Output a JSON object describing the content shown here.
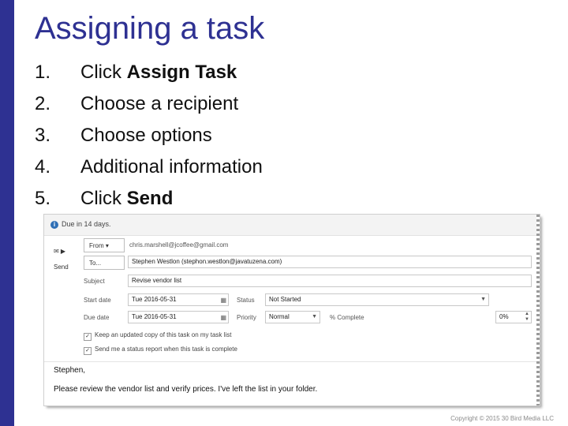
{
  "slide": {
    "title": "Assigning a task",
    "steps": [
      {
        "num": "1.",
        "pre": "Click ",
        "bold": "Assign Task"
      },
      {
        "num": "2.",
        "pre": "Choose a recipient",
        "bold": ""
      },
      {
        "num": "3.",
        "pre": "Choose options",
        "bold": ""
      },
      {
        "num": "4.",
        "pre": "Additional information",
        "bold": ""
      },
      {
        "num": "5.",
        "pre": "Click ",
        "bold": "Send"
      }
    ],
    "copyright": "Copyright © 2015 30 Bird Media LLC"
  },
  "task": {
    "info": "Due in 14 days.",
    "send_label": "Send",
    "from_label": "From ▾",
    "from_value": "chris.marshell@jcoffee@gmail.com",
    "to_label": "To...",
    "to_value": "Stephen Westlon (stephon.westlon@javatuzena.com)",
    "subject_label": "Subject",
    "subject_value": "Revise vendor list",
    "start_label": "Start date",
    "start_value": "Tue 2016-05-31",
    "due_label": "Due date",
    "due_value": "Tue 2016-05-31",
    "status_label": "Status",
    "status_value": "Not Started",
    "priority_label": "Priority",
    "priority_value": "Normal",
    "complete_label": "% Complete",
    "complete_value": "0%",
    "check1": "Keep an updated copy of this task on my task list",
    "check2": "Send me a status report when this task is complete",
    "body_line1": "Stephen,",
    "body_line2": "Please review the vendor list and verify prices. I've left the list in your folder."
  },
  "colors": {
    "accent": "#2e3192"
  }
}
